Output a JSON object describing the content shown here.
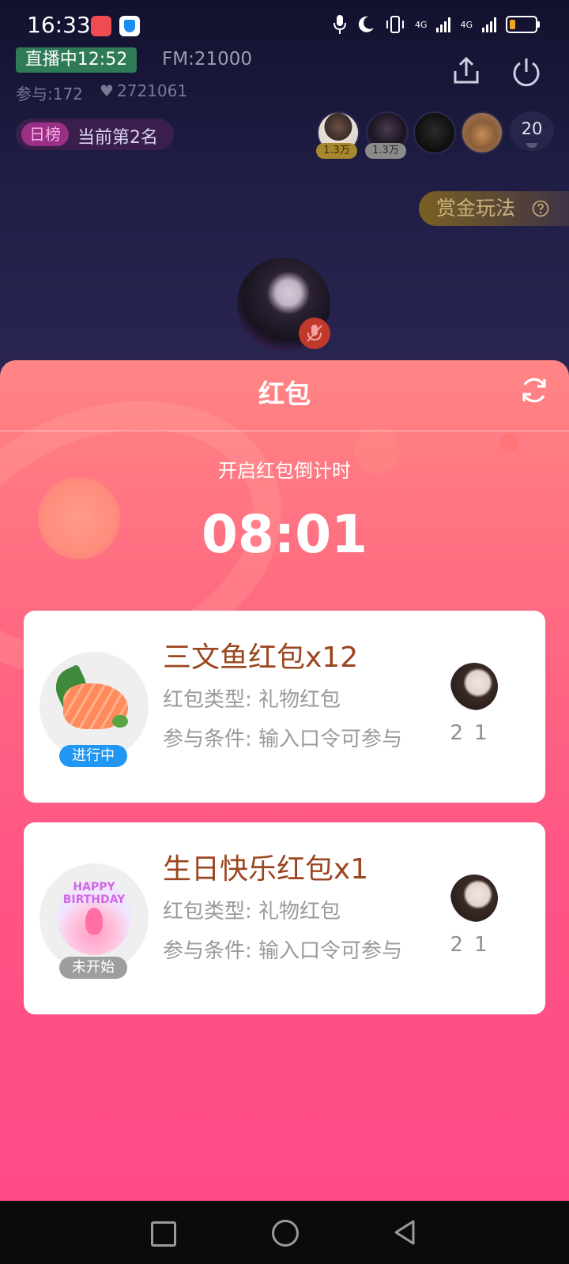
{
  "status_bar": {
    "time": "16:33",
    "network_1": "4G",
    "network_2": "4G",
    "icons": [
      "app-badge-red",
      "shield-icon",
      "mic-icon",
      "moon-icon",
      "vibrate-icon",
      "signal-icon",
      "signal-icon",
      "battery-icon"
    ]
  },
  "room": {
    "live_label": "直播中12:52",
    "fm": "FM:21000",
    "participants": "参与:172",
    "likes": "2721061",
    "rank_tag": "日榜",
    "rank_text": "当前第2名",
    "viewer_count": "20",
    "top_scores": [
      "1.3万",
      "1.3万"
    ],
    "bounty_label": "赏金玩法"
  },
  "panel": {
    "title": "红包",
    "countdown_label": "开启红包倒计时",
    "countdown": "08:01",
    "packets": [
      {
        "name": "三文鱼红包x12",
        "type": "红包类型:  礼物红包",
        "condition": "参与条件:  输入口令可参与",
        "status": "进行中",
        "count": "21"
      },
      {
        "name": "生日快乐红包x1",
        "type": "红包类型:  礼物红包",
        "condition": "参与条件:  输入口令可参与",
        "status": "未开始",
        "count": "21",
        "image_text": "HAPPY BIRTHDAY"
      }
    ]
  },
  "colors": {
    "accent": "#ff5585",
    "live": "#2f7a57",
    "active_tag": "#2196f3",
    "pending_tag": "#9e9e9e",
    "gift_name": "#9b4620"
  }
}
